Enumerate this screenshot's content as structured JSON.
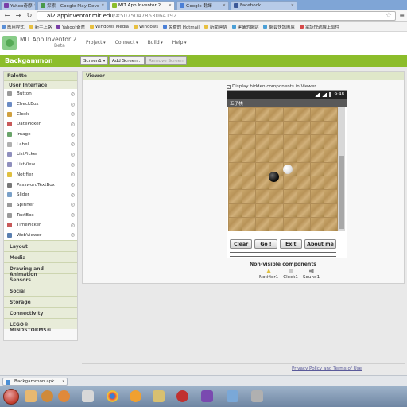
{
  "browser": {
    "tabs": [
      {
        "label": "Yahoo奇摩",
        "active": false
      },
      {
        "label": "探索 - Google Play Deve",
        "active": false
      },
      {
        "label": "MIT App Inventor 2",
        "active": true
      },
      {
        "label": "Google 翻譯",
        "active": false
      },
      {
        "label": "Facebook",
        "active": false
      }
    ],
    "url_host": "ai2.appinventor.mit.edu",
    "url_path": "/#5075047853064192",
    "bookmarks": [
      "應用程式",
      "新手上路",
      "Yahoo!奇摩",
      "Windows Media",
      "Windows",
      "免費的 Hotmail",
      "新聞連結",
      "建議的網站",
      "網頁快訊圖庫",
      "電話快遞線上取件"
    ]
  },
  "app": {
    "brand": "MIT App Inventor 2",
    "beta": "Beta",
    "menu": [
      "Project",
      "Connect",
      "Build",
      "Help"
    ],
    "project_name": "Backgammon",
    "screen_dropdown": "Screen1 ▾",
    "add_screen": "Add Screen...",
    "remove_screen": "Remove Screen"
  },
  "palette": {
    "title": "Palette",
    "section": "User Interface",
    "items": [
      {
        "label": "Button",
        "icon": "button-icon",
        "color": "#9a9a9a"
      },
      {
        "label": "CheckBox",
        "icon": "checkbox-icon",
        "color": "#6b8bc4"
      },
      {
        "label": "Clock",
        "icon": "clock-icon",
        "color": "#d0a040"
      },
      {
        "label": "DatePicker",
        "icon": "datepicker-icon",
        "color": "#c85a5a"
      },
      {
        "label": "Image",
        "icon": "image-icon",
        "color": "#6aa46a"
      },
      {
        "label": "Label",
        "icon": "label-icon",
        "color": "#b0b0b0"
      },
      {
        "label": "ListPicker",
        "icon": "listpicker-icon",
        "color": "#8f8fbd"
      },
      {
        "label": "ListView",
        "icon": "listview-icon",
        "color": "#8f8fbd"
      },
      {
        "label": "Notifier",
        "icon": "notifier-icon",
        "color": "#e0c040"
      },
      {
        "label": "PasswordTextBox",
        "icon": "password-icon",
        "color": "#777777"
      },
      {
        "label": "Slider",
        "icon": "slider-icon",
        "color": "#7aa0c8"
      },
      {
        "label": "Spinner",
        "icon": "spinner-icon",
        "color": "#9a9a9a"
      },
      {
        "label": "TextBox",
        "icon": "textbox-icon",
        "color": "#9a9a9a"
      },
      {
        "label": "TimePicker",
        "icon": "timepicker-icon",
        "color": "#c85a5a"
      },
      {
        "label": "WebViewer",
        "icon": "webviewer-icon",
        "color": "#5a7fb0"
      }
    ],
    "categories": [
      "Layout",
      "Media",
      "Drawing and Animation",
      "Sensors",
      "Social",
      "Storage",
      "Connectivity",
      "LEGO® MINDSTORMS®"
    ]
  },
  "viewer": {
    "title": "Viewer",
    "hidden_label": "Display hidden components in Viewer",
    "phone": {
      "time": "9:48",
      "title": "五子棋",
      "buttons": [
        "Clear",
        "Go !",
        "Exit",
        "About me"
      ]
    },
    "nonvisible_title": "Non-visible components",
    "nonvisible": [
      "Notifier1",
      "Clock1",
      "Sound1"
    ]
  },
  "footer": {
    "link": "Privacy Policy and Terms of Use"
  },
  "download": {
    "file": "Backgammon.apk"
  },
  "colors": {
    "accent": "#8cbd2b",
    "palette_header": "#dfe7c9"
  }
}
